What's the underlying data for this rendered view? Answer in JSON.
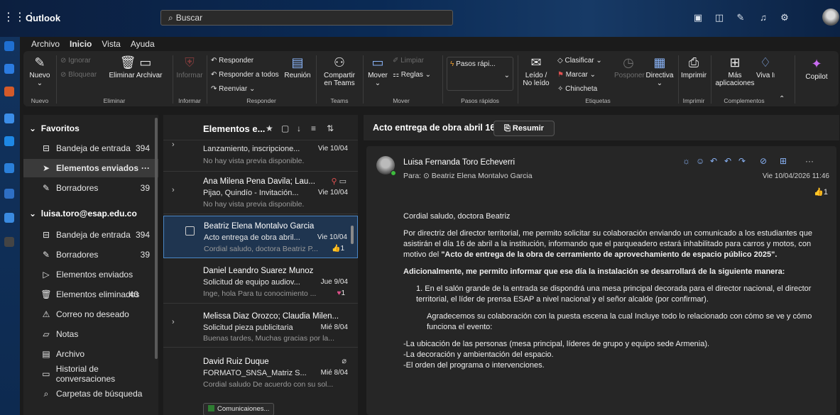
{
  "app": {
    "title": "Outlook",
    "search_placeholder": "Buscar"
  },
  "menu": [
    "Archivo",
    "Inicio",
    "Vista",
    "Ayuda"
  ],
  "ribbon": {
    "nuevo": "Nuevo",
    "nuevo_group": "Nuevo",
    "ignorar": "Ignorar",
    "bloquear": "Bloquear",
    "eliminar_archivar": "Eliminar Archivar",
    "eliminar_group": "Eliminar",
    "informar": "Informar",
    "informar_group": "Informar",
    "responder": "Responder",
    "responder_todos": "Responder a todos",
    "reenviar": "Reenviar",
    "reunion": "Reunión",
    "responder_group": "Responder",
    "compartir": "Compartir en Teams",
    "teams_group": "Teams",
    "mover": "Mover",
    "limpiar": "Limpiar",
    "reglas": "Reglas",
    "mover_group": "Mover",
    "pasos": "Pasos rápi...",
    "pasos_group": "Pasos rápidos",
    "leido": "Leído / No leído",
    "clasificar": "Clasificar",
    "marcar": "Marcar",
    "chincheta": "Chincheta",
    "posponer": "Posponer",
    "directiva": "Directiva",
    "etiquetas_group": "Etiquetas",
    "imprimir": "Imprimir",
    "imprimir_group": "Imprimir",
    "mas_apps": "Más aplicaciones",
    "viva": "Viva Insights",
    "complementos_group": "Complementos",
    "copilot": "Copilot"
  },
  "nav": {
    "favoritos": "Favoritos",
    "fav_items": [
      {
        "label": "Bandeja de entrada",
        "count": "394"
      },
      {
        "label": "Elementos enviados",
        "count": "···"
      },
      {
        "label": "Borradores",
        "count": "39"
      }
    ],
    "account": "luisa.toro@esap.edu.co",
    "acc_items": [
      {
        "label": "Bandeja de entrada",
        "count": "394"
      },
      {
        "label": "Borradores",
        "count": "39"
      },
      {
        "label": "Elementos enviados",
        "count": ""
      },
      {
        "label": "Elementos eliminados",
        "count": "40"
      },
      {
        "label": "Correo no deseado",
        "count": ""
      },
      {
        "label": "Notas",
        "count": ""
      },
      {
        "label": "Archivo",
        "count": ""
      },
      {
        "label": "Historial de conversaciones",
        "count": ""
      },
      {
        "label": "Carpetas de búsqueda",
        "count": ""
      }
    ]
  },
  "list": {
    "title": "Elementos e...",
    "messages": [
      {
        "from": "",
        "subject": "Lanzamiento, inscripcione...",
        "date": "Vie 10/04",
        "preview": "No hay vista previa disponible."
      },
      {
        "from": "Ana Milena Pena Davila; Lau...",
        "subject": "Pijao, Quindío - Invitación...",
        "date": "Vie 10/04",
        "preview": "No hay vista previa disponible."
      },
      {
        "from": "Beatriz Elena Montalvo Garcia",
        "subject": "Acto entrega de obra abril...",
        "date": "Vie 10/04",
        "preview": "Cordial saludo, doctora Beatriz P...",
        "badge": "1"
      },
      {
        "from": "Daniel Leandro Suarez Munoz",
        "subject": "Solicitud de equipo audiov...",
        "date": "Jue 9/04",
        "preview": "Inge, hola Para tu conocimiento ...",
        "badge": "1"
      },
      {
        "from": "Melissa Diaz Orozco; Claudia Milen...",
        "subject": "Solicitud pieza publicitaria",
        "date": "Mié 8/04",
        "preview": "Buenas tardes, Muchas gracias por la..."
      },
      {
        "from": "David Ruiz Duque",
        "subject": "FORMATO_SNSA_Matriz S...",
        "date": "Mié 8/04",
        "preview": "Cordial saludo De acuerdo con su sol...",
        "chip": "Comunicaiones..."
      }
    ]
  },
  "read": {
    "subject": "Acto entrega de obra abril 16",
    "summarize": "Resumir",
    "sender": "Luisa Fernanda Toro Echeverri",
    "to_label": "Para:",
    "to": "Beatriz Elena Montalvo Garcia",
    "date": "Vie 10/04/2026 11:46",
    "reaction_count": "1",
    "greeting": "Cordial saludo, doctora Beatriz",
    "p1": "Por directriz del director territorial, me permito solicitar su colaboración enviando un comunicado a los estudiantes que asistirán el día 16 de abril a la institución, informando que el parqueadero estará inhabilitado para carros y motos, con motivo del ",
    "p1_bold": "\"Acto de entrega de la obra de cerramiento de aprovechamiento de espacio público 2025\".",
    "p2": "Adicionalmente, me permito informar que ese día la instalación se desarrollará de la siguiente manera:",
    "li1": "1. En el salón grande de la entrada se dispondrá una mesa principal decorada para el director nacional, el director territorial, el líder de prensa ESAP a nivel nacional y el señor alcalde (por confirmar).",
    "p3": "Agradecemos su colaboración con la puesta escena la cual Incluye todo lo relacionado con cómo se ve y cómo funciona el evento:",
    "b1": "-La ubicación de las personas (mesa principal, líderes de grupo y equipo sede Armenia).",
    "b2": "-La decoración y ambientación del espacio.",
    "b3": "-El orden del programa o intervenciones."
  }
}
